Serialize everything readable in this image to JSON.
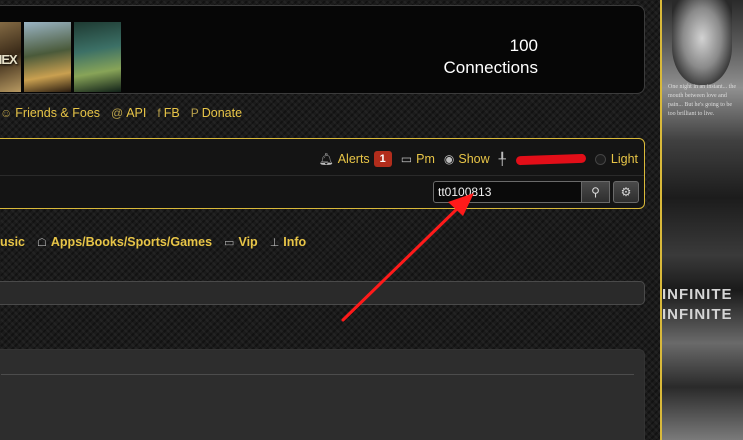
{
  "header": {
    "posters": [
      {
        "label": "HEX",
        "name": "poster-1"
      },
      {
        "label": "",
        "name": "poster-2"
      },
      {
        "label": "",
        "name": "poster-3"
      }
    ],
    "connections_count": "100",
    "connections_label": "Connections"
  },
  "footer_links": [
    {
      "icon": "smiley-icon",
      "glyph": "☺",
      "label": "Friends & Foes"
    },
    {
      "icon": "at-icon",
      "glyph": "@",
      "label": "API"
    },
    {
      "icon": "facebook-icon",
      "glyph": "f",
      "label": "FB"
    },
    {
      "icon": "paypal-icon",
      "glyph": "P",
      "label": "Donate"
    }
  ],
  "toolbar": {
    "alerts_label": "Alerts",
    "alerts_count": "1",
    "pm_label": "Pm",
    "show_label": "Show",
    "light_label": "Light",
    "username_redacted_color": "#e30e18"
  },
  "search": {
    "value": "tt0100813",
    "placeholder": ""
  },
  "nav": {
    "categories": [
      {
        "icon": "",
        "glyph": "",
        "label": "usic"
      },
      {
        "icon": "android-icon",
        "glyph": "☖",
        "label": "Apps/Books/Sports/Games"
      },
      {
        "icon": "folder-icon",
        "glyph": "▭",
        "label": "Vip"
      },
      {
        "icon": "pin-icon",
        "glyph": "⊥",
        "label": "Info"
      }
    ]
  },
  "side_poster": {
    "tagline": "One night in an instant... the mouth between love and pain... But he's going to be too brilliant to live.",
    "title_line1": "INFINITE",
    "title_line2": "INFINITE"
  },
  "colors": {
    "accent_gold": "#e8c547",
    "border_gold": "#d9b93a",
    "badge_red": "#b22d1c",
    "annotation_arrow": "#ff1a1a"
  }
}
